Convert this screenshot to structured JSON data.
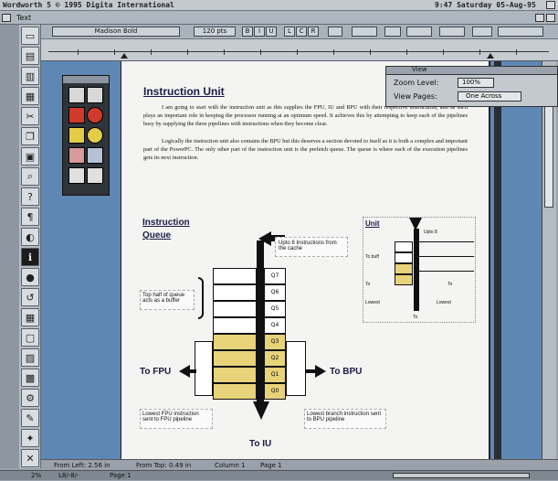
{
  "app": {
    "title": "Wordworth 5  © 1995 Digita International",
    "clock": "9:47 Saturday 05-Aug-95",
    "window_title": "Text"
  },
  "ribbon": {
    "font_name": "Madison Bold",
    "font_size": "120 pts",
    "style_buttons": [
      "B",
      "I",
      "U"
    ],
    "align_buttons": [
      "L",
      "C",
      "R"
    ]
  },
  "zoom_window": {
    "title": "View",
    "zoom_label": "Zoom Level:",
    "zoom_value": "100%",
    "view_label": "View Pages:",
    "view_value": "One Across"
  },
  "document": {
    "heading": "Instruction Unit",
    "para1": "I am going to start with the instruction unit as this supplies the FPU, IU and BPU with their respective instructions, and as such plays an important role in keeping the processor running at an optimum speed. It achieves this by attempting to keep each of the pipelines busy by supplying the three pipelines with instructions when they become clear.",
    "para2": "Logically the instruction unit also contains the BPU but this deserves a section devoted to itself as it is both a complex and important part of the PowerPC. The only other part of the instruction unit is the prefetch queue. The queue is where each of the execution pipelines gets its next instruction.",
    "queue_heading": "Instruction Queue",
    "mini_heading": "Unit",
    "callout_top": "Upto 8 Instructions from the cache",
    "callout_buffer": "Top half of queue acts as a buffer",
    "callout_fpu": "Lowest FPU instruction sent to FPU pipeline",
    "callout_bpu": "Lowest branch instruction sent to BPU pipeline",
    "label_fpu": "To FPU",
    "label_bpu": "To BPU",
    "label_iu": "To IU",
    "slots": [
      "Q7",
      "Q6",
      "Q5",
      "Q4",
      "Q3",
      "Q2",
      "Q1",
      "Q0"
    ],
    "mini_labels": [
      "Upto 8",
      "To buff",
      "To",
      "To",
      "Lowest",
      "Lowest",
      "To"
    ]
  },
  "status": {
    "from_left": "From Left: 2.56 in",
    "from_top": "From Top: 0.49 in",
    "column": "Column 1",
    "page": "Page 1"
  },
  "bottom": {
    "left": "2%",
    "mid": "L8/-8/-",
    "page": "Page 1"
  },
  "colors": {
    "workspace": "#5f87b4",
    "highlight": "#e8d27a",
    "heading": "#1b1b4a"
  }
}
